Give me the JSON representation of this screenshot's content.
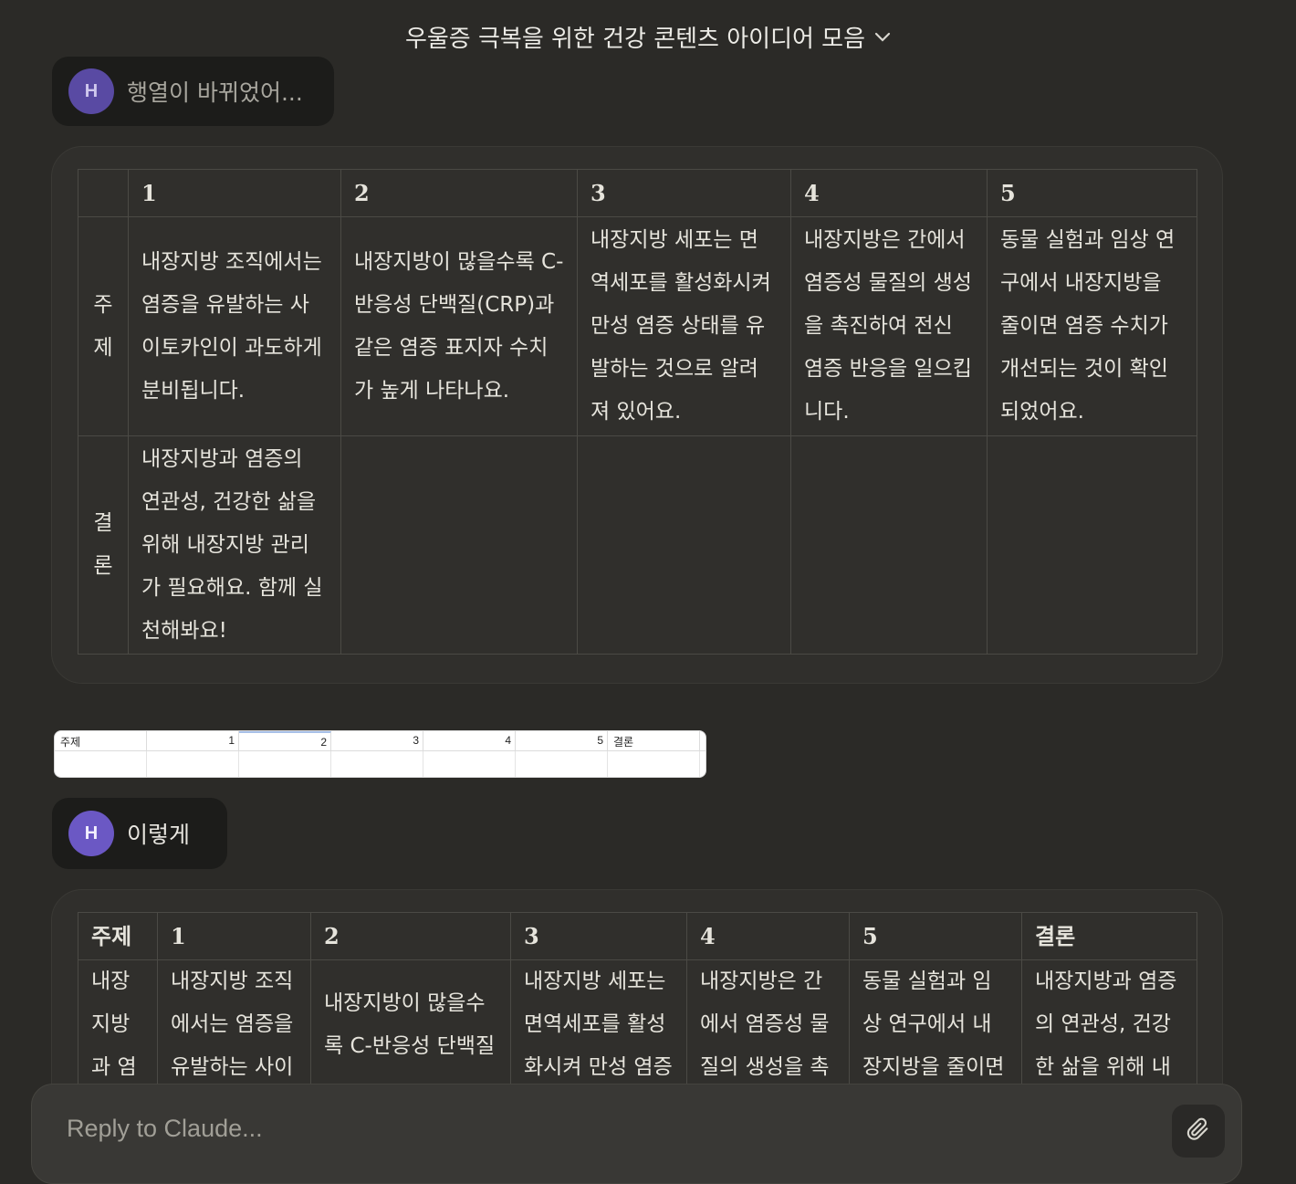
{
  "header": {
    "title": "우울증 극복을 위한 건강 콘텐츠 아이디어 모음"
  },
  "messages": {
    "first": {
      "avatar": "H",
      "text": "행열이 바뀌었어..."
    },
    "second": {
      "avatar": "H",
      "text": "이렇게"
    }
  },
  "table1": {
    "headers": [
      "",
      "1",
      "2",
      "3",
      "4",
      "5"
    ],
    "rows": [
      {
        "label": "주\n제",
        "cells": [
          "내장지방 조직에서는 염증을 유발하는 사이토카인이 과도하게 분비됩니다.",
          "내장지방이 많을수록 C-반응성 단백질(CRP)과 같은 염증 표지자 수치가 높게 나타나요.",
          "내장지방 세포는 면역세포를 활성화시켜 만성 염증 상태를 유발하는 것으로 알려져 있어요.",
          "내장지방은 간에서 염증성 물질의 생성을 촉진하여 전신 염증 반응을 일으킵니다.",
          "동물 실험과 임상 연구에서 내장지방을 줄이면 염증 수치가 개선되는 것이 확인되었어요."
        ]
      },
      {
        "label": "결\n론",
        "cells": [
          "내장지방과 염증의 연관성, 건강한 삶을 위해 내장지방 관리가 필요해요. 함께 실천해봐요!",
          "",
          "",
          "",
          ""
        ]
      }
    ]
  },
  "sheet": {
    "cells": [
      "주제",
      "1",
      "2",
      "3",
      "4",
      "5",
      "결론"
    ]
  },
  "table2": {
    "headers": [
      "주제",
      "1",
      "2",
      "3",
      "4",
      "5",
      "결론"
    ],
    "row": [
      "내장지방과 염",
      "내장지방 조직에서는 염증을 유발하는 사이",
      "내장지방이 많을수록 C-반응성 단백질",
      "내장지방 세포는 면역세포를 활성화시켜 만성 염증",
      "내장지방은 간에서 염증성 물질의 생성을 촉",
      "동물 실험과 임상 연구에서 내장지방을 줄이면 염증",
      "내장지방과 염증의 연관성, 건강한 삶을 위해 내"
    ]
  },
  "composer": {
    "placeholder": "Reply to Claude..."
  },
  "icons": {
    "title_chevron": "chevron-down-icon",
    "attach": "paperclip-icon"
  }
}
